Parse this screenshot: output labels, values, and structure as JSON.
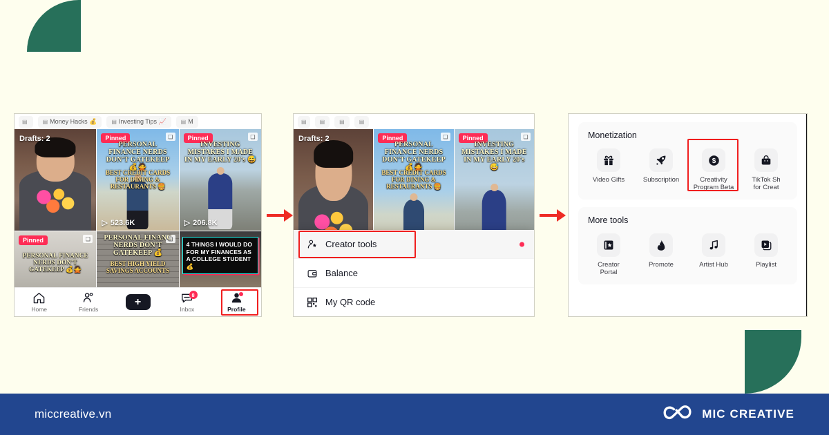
{
  "background_color": "#FEFEEE",
  "accent_colors": {
    "green": "#27705A",
    "footer_blue": "#22468F",
    "highlight_red": "#F01E1E",
    "arrow_red": "#EE2B24",
    "tiktok_pink": "#FE2C55",
    "tiktok_cyan": "#25F4EE"
  },
  "footer": {
    "url": "miccreative.vn",
    "brand": "MIC CREATIVE",
    "logo_icon": "infinity-loop-logo"
  },
  "arrows": [
    {
      "name": "arrow-step-1-to-2",
      "direction": "right"
    },
    {
      "name": "arrow-step-2-to-3",
      "direction": "right"
    }
  ],
  "shot1": {
    "name": "tiktok-profile-video-grid",
    "playlist_chips": [
      {
        "label": "",
        "icon": "playlist-icon"
      },
      {
        "label": "Money Hacks 💰",
        "icon": "playlist-icon"
      },
      {
        "label": "Investing Tips 📈",
        "icon": "playlist-icon"
      },
      {
        "label": "M",
        "icon": "playlist-icon"
      }
    ],
    "grid": [
      {
        "name": "drafts-tile",
        "drafts_label": "Drafts: 2",
        "pinned": false,
        "views": "",
        "overlay_title": "",
        "overlay_sub": ""
      },
      {
        "name": "video-tile-pinned-1",
        "pinned": true,
        "pinned_label": "Pinned",
        "views": "523.6K",
        "overlay_title": "PERSONAL FINANCE NERDS DON'T GATEKEEP 💰🙅",
        "overlay_sub": "BEST CREDIT CARDS FOR DINING & RESTAURANTS 🍔"
      },
      {
        "name": "video-tile-pinned-2",
        "pinned": true,
        "pinned_label": "Pinned",
        "views": "206.8K",
        "overlay_title": "INVESTING MISTAKES I MADE IN MY EARLY 20's 😅",
        "overlay_sub": ""
      },
      {
        "name": "video-tile-pinned-3",
        "pinned": true,
        "pinned_label": "Pinned",
        "views": "",
        "overlay_title": "PERSONAL FINANCE NERDS DON'T GATEKEEP 💰🙅",
        "overlay_sub": ""
      },
      {
        "name": "video-tile-4",
        "pinned": false,
        "views": "",
        "overlay_title": "PERSONAL FINANC NERDS DON'T GATEKEEP 💰",
        "overlay_sub": "BEST HIGH YIELD SAVINGS ACCOUNTS"
      },
      {
        "name": "video-tile-5",
        "pinned": false,
        "views": "",
        "card_text": "4 THINGS I WOULD DO FOR MY FINANCES AS A COLLEGE STUDENT 💰"
      }
    ],
    "navbar": [
      {
        "name": "nav-home",
        "label": "Home",
        "icon": "home-icon",
        "active": false
      },
      {
        "name": "nav-friends",
        "label": "Friends",
        "icon": "friends-icon",
        "active": false
      },
      {
        "name": "nav-create",
        "label": "",
        "icon": "plus-icon",
        "active": false
      },
      {
        "name": "nav-inbox",
        "label": "Inbox",
        "icon": "inbox-icon",
        "badge": "8",
        "active": false
      },
      {
        "name": "nav-profile",
        "label": "Profile",
        "icon": "person-icon",
        "active": true,
        "has_dot": true
      }
    ],
    "highlight": "Profile"
  },
  "shot2": {
    "name": "tiktok-profile-menu-sheet",
    "menu_items": [
      {
        "name": "menu-creator-tools",
        "label": "Creator tools",
        "icon": "person-star-icon",
        "dot": true,
        "highlighted": true
      },
      {
        "name": "menu-balance",
        "label": "Balance",
        "icon": "wallet-icon",
        "dot": false,
        "highlighted": false
      },
      {
        "name": "menu-my-qr-code",
        "label": "My QR code",
        "icon": "qr-code-icon",
        "dot": false,
        "highlighted": false
      }
    ],
    "drafts_label": "Drafts: 2",
    "pinned_label": "Pinned"
  },
  "shot3": {
    "name": "tiktok-creator-tools-screen",
    "sections": [
      {
        "name": "monetization-section",
        "title": "Monetization",
        "items": [
          {
            "name": "tool-video-gifts",
            "label": "Video Gifts",
            "icon": "gift-icon",
            "highlighted": false
          },
          {
            "name": "tool-subscription",
            "label": "Subscription",
            "icon": "rocket-icon",
            "highlighted": false
          },
          {
            "name": "tool-creativity-program",
            "label": "Creativity\nProgram Beta",
            "icon": "dollar-coin-icon",
            "highlighted": true
          },
          {
            "name": "tool-tiktok-shop",
            "label": "TikTok Sh\nfor Creat",
            "icon": "shopping-bag-icon",
            "highlighted": false
          }
        ]
      },
      {
        "name": "more-tools-section",
        "title": "More tools",
        "items": [
          {
            "name": "tool-creator-portal",
            "label": "Creator\nPortal",
            "icon": "book-star-icon",
            "highlighted": false
          },
          {
            "name": "tool-promote",
            "label": "Promote",
            "icon": "flame-icon",
            "highlighted": false
          },
          {
            "name": "tool-artist-hub",
            "label": "Artist Hub",
            "icon": "music-note-icon",
            "highlighted": false
          },
          {
            "name": "tool-playlist",
            "label": "Playlist",
            "icon": "playlist-icon",
            "highlighted": false
          }
        ]
      }
    ],
    "highlight": "Creativity Program Beta"
  }
}
